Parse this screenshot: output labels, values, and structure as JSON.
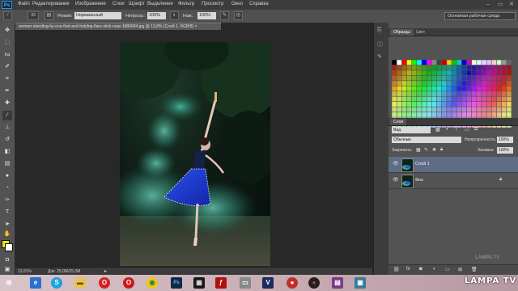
{
  "app": {
    "logo": "Ps"
  },
  "menu": [
    "Файл",
    "Редактирование",
    "Изображение",
    "Слои",
    "Шрифт",
    "Выделение",
    "Фильтр",
    "Просмотр",
    "Окно",
    "Справка"
  ],
  "window_controls": [
    "–",
    "▭",
    "✕"
  ],
  "options": {
    "brush_size": "33",
    "mode_label": "Режим:",
    "mode_value": "Нормальный",
    "opacity_label": "Непрозр.:",
    "opacity_value": "100%",
    "flow_label": "Наж.:",
    "flow_value": "100%",
    "workspace": "Основная рабочая среда"
  },
  "document": {
    "tab_title": "woman-standing-by-one-foot-and-holding-flare-stick-near-1886694.jpg @ 13,8% (Слой 1, RGB/8) ×"
  },
  "status": {
    "zoom": "13,81%",
    "doc_size": "Док: 25,0М/25,0М"
  },
  "panels": {
    "swatches_tabs": [
      "Образцы",
      "Цвет"
    ],
    "layers_tabs": [
      "Слои"
    ],
    "filter_kind": "Вид",
    "blend_mode": "Обычные",
    "opacity_label": "Непрозрачность:",
    "opacity_value": "100%",
    "lock_label": "Закрепить:",
    "fill_label": "Заливка:",
    "fill_value": "100%",
    "layers": [
      {
        "name": "Слой 1",
        "selected": true
      },
      {
        "name": "Фон",
        "selected": false
      }
    ]
  },
  "taskbar": {
    "icons": [
      "internet-explorer",
      "skype",
      "file-explorer",
      "opera",
      "opera-2",
      "chrome",
      "photoshop",
      "video-editor",
      "flash",
      "window",
      "vegas",
      "media-player",
      "recorder",
      "archive",
      "app"
    ]
  },
  "watermark": {
    "small": "LAMPA.TV",
    "large": "LAMPA TV"
  },
  "colors": {
    "foreground": "#f3e600",
    "background": "#ffffff",
    "selected_layer": "#5e6c85",
    "dress": "#1f3ed8",
    "smoke": "#4fd1b8"
  }
}
